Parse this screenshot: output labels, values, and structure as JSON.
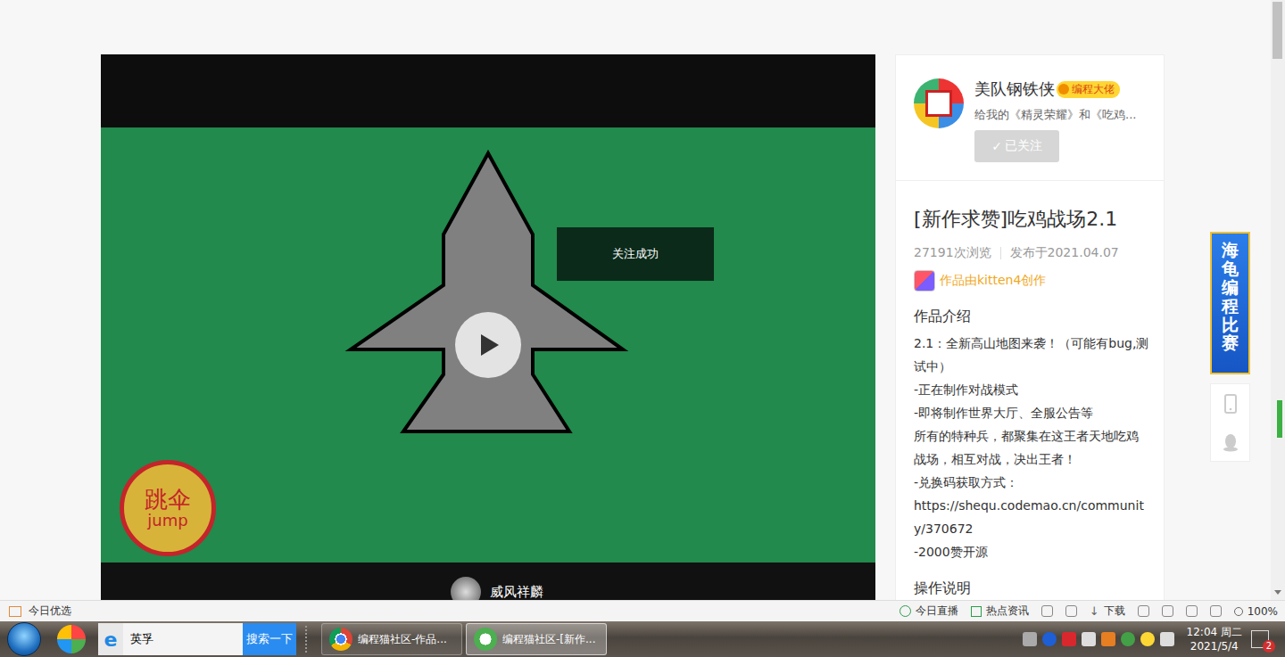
{
  "player": {
    "toast": "关注成功",
    "jump_button": {
      "line1": "跳伞",
      "line2": "jump"
    },
    "player_name": "威风祥麟"
  },
  "author": {
    "name": "美队钢铁侠",
    "badge": "编程大佬",
    "bio": "给我的《精灵荣耀》和《吃鸡...",
    "follow_button": {
      "icon": "✓",
      "label": "已关注",
      "following": true
    }
  },
  "work": {
    "title": "[新作求赞]吃鸡战场2.1",
    "views": "27191次浏览",
    "published": "发布于2021.04.07",
    "made_with": "作品由kitten4创作",
    "intro_heading": "作品介绍",
    "intro_lines": [
      "2.1：全新高山地图来袭！（可能有bug,测试中）",
      "-正在制作对战模式",
      "-即将制作世界大厅、全服公告等",
      "所有的特种兵，都聚集在这王者天地吃鸡战场，相互对战，决出王者！",
      "-兑换码获取方式：",
      "https://shequ.codemao.cn/community/370672",
      "-2000赞开源"
    ],
    "controls_heading": "操作说明"
  },
  "side_ad": {
    "text": "海龟编程比赛"
  },
  "status_bar": {
    "left": "今日优选",
    "live": "今日直播",
    "news": "热点资讯",
    "download": "下载",
    "zoom": "100%"
  },
  "taskbar": {
    "search": {
      "value": "英孚",
      "button": "搜索一下"
    },
    "tasks": [
      {
        "label": "编程猫社区-作品...",
        "kind": "chrome",
        "selected": false
      },
      {
        "label": "编程猫社区-[新作...",
        "kind": "360",
        "selected": true
      }
    ],
    "clock": {
      "time": "12:04 周二",
      "date": "2021/5/4"
    },
    "notification_count": "2"
  }
}
